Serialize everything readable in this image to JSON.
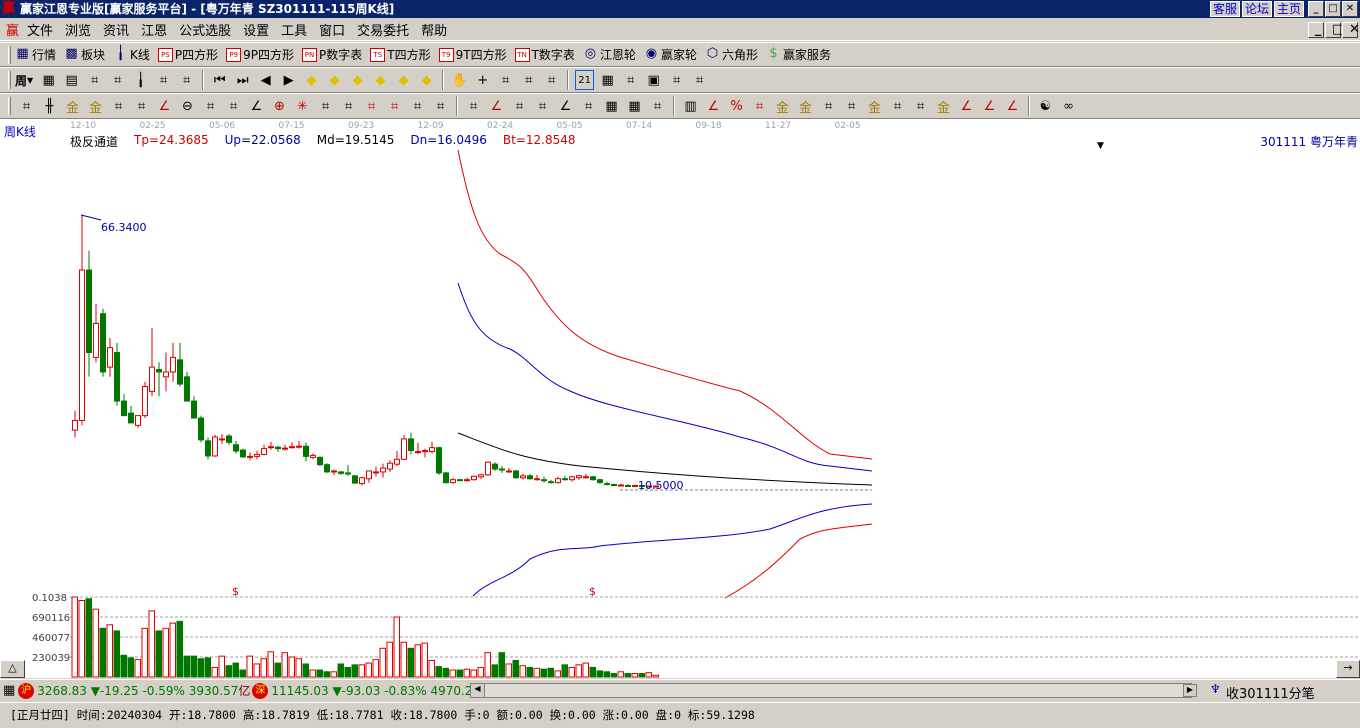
{
  "window": {
    "title": "赢家江恩专业版[赢家服务平台] - [粤万年青   SZ301111-115周K线]",
    "links": [
      "客服",
      "论坛",
      "主页"
    ],
    "controls": [
      "_",
      "□",
      "✕"
    ]
  },
  "menu": [
    "文件",
    "浏览",
    "资讯",
    "江恩",
    "公式选股",
    "设置",
    "工具",
    "窗口",
    "交易委托",
    "帮助"
  ],
  "toolbar1": [
    {
      "icon": "quote-table-icon",
      "glyph": "▦",
      "label": "行情"
    },
    {
      "icon": "sector-icon",
      "glyph": "▩",
      "label": "板块"
    },
    {
      "icon": "kline-icon",
      "glyph": "╽",
      "label": "K线"
    },
    {
      "icon": "ps-icon",
      "glyph": "PS",
      "label": "P四方形"
    },
    {
      "icon": "p9-icon",
      "glyph": "P9",
      "label": "9P四方形"
    },
    {
      "icon": "pn-icon",
      "glyph": "PN",
      "label": "P数字表"
    },
    {
      "icon": "ts-icon",
      "glyph": "TS",
      "label": "T四方形"
    },
    {
      "icon": "t9-icon",
      "glyph": "T9",
      "label": "9T四方形"
    },
    {
      "icon": "tn-icon",
      "glyph": "TN",
      "label": "T数字表"
    },
    {
      "icon": "gann-wheel-icon",
      "glyph": "◎",
      "label": "江恩轮"
    },
    {
      "icon": "winner-wheel-icon",
      "glyph": "◉",
      "label": "赢家轮"
    },
    {
      "icon": "hexagon-icon",
      "glyph": "⬡",
      "label": "六角形"
    },
    {
      "icon": "dollar-icon",
      "glyph": "$",
      "label": "赢家服务"
    }
  ],
  "toolbar2": {
    "period": "周",
    "icons": [
      "grid-icon",
      "doc-icon",
      "bars3-icon",
      "bars9-icon",
      "candle-icon",
      "extreme-icon",
      "mountain-icon",
      "first-icon",
      "last-icon",
      "left-icon",
      "right-icon",
      "up-diamond-icon",
      "right-diamond-icon",
      "down-diamond-icon",
      "star-diamond-icon",
      "cross-diamond-icon",
      "move-diamond-icon",
      "hand-icon",
      "crosshair-icon",
      "trend-icon",
      "tree-icon",
      "pattern-icon",
      "calendar-icon",
      "calculator-icon",
      "notes-icon",
      "save-icon",
      "network-icon",
      "print-icon"
    ],
    "calendar_text": "21"
  },
  "toolbar3": {
    "icons": [
      "pen-icon",
      "lines-icon",
      "gold1-icon",
      "gold2-icon",
      "fib-icon",
      "spiral-icon",
      "fan-icon",
      "circle-icon",
      "parallel-icon",
      "n2-icon",
      "angle-icon",
      "target-icon",
      "star-icon",
      "box-icon",
      "speed-icon",
      "shen-icon",
      "ying-icon",
      "comb-icon",
      "measure-icon",
      "frame-icon",
      "fan2-icon",
      "square-icon",
      "square2-icon",
      "angle2-icon",
      "wave-icon",
      "grid2-icon",
      "grid3-icon",
      "slash-icon",
      "table-icon",
      "percent-fan-icon",
      "percent-icon",
      "percent-line-icon",
      "gold-circle-icon",
      "gold-line-icon",
      "drop-icon",
      "wave2-icon",
      "gold3-icon",
      "j-icon",
      "f-icon",
      "gold-angle-icon",
      "shen-angle-icon",
      "ying-angle-icon",
      "four-angle-icon",
      "yinyang-icon",
      "infinity-icon"
    ]
  },
  "chart": {
    "period_label": "周K线",
    "indicator": "极反通道",
    "tp": "Tp=24.3685",
    "up": "Up=22.0568",
    "md": "Md=19.5145",
    "dn": "Dn=16.0496",
    "bt": "Bt=12.8548",
    "stock": "301111  粤万年青",
    "high_label": "66.3400",
    "low_label": "10.5000",
    "dates": [
      "12-10",
      "02-25",
      "05-06",
      "07-15",
      "09-23",
      "12-09",
      "02-24",
      "05-05",
      "07-14",
      "09-18",
      "11-27",
      "02-05"
    ],
    "candles": [
      [
        22,
        26,
        20.5,
        24
      ],
      [
        24,
        66.34,
        23,
        55
      ],
      [
        55,
        59,
        33,
        38
      ],
      [
        37,
        48,
        36,
        44
      ],
      [
        46,
        47,
        33,
        34
      ],
      [
        35,
        41,
        33,
        39
      ],
      [
        38,
        40,
        27,
        28
      ],
      [
        28,
        29.5,
        25,
        25
      ],
      [
        25.5,
        27,
        23.5,
        23.5
      ],
      [
        23,
        25,
        22.5,
        25
      ],
      [
        25,
        32,
        24.5,
        31
      ],
      [
        30,
        43,
        29,
        35
      ],
      [
        34.5,
        36,
        29,
        34
      ],
      [
        33,
        38,
        30,
        34
      ],
      [
        34,
        40,
        32,
        37
      ],
      [
        36.5,
        40,
        31,
        31.5
      ],
      [
        33,
        34,
        28,
        28
      ],
      [
        28,
        29,
        24.5,
        24.5
      ],
      [
        24.5,
        25,
        19.5,
        20
      ],
      [
        19.8,
        20.5,
        16,
        16.7
      ],
      [
        16.7,
        21,
        16.5,
        20.6
      ],
      [
        20,
        21.2,
        19.2,
        20.2
      ],
      [
        20.8,
        21.2,
        19,
        19.5
      ],
      [
        19,
        19.8,
        17.2,
        17.7
      ],
      [
        17.9,
        18.2,
        16.3,
        16.5
      ],
      [
        16.5,
        17.4,
        15.8,
        16.6
      ],
      [
        16.6,
        17.8,
        16,
        17
      ],
      [
        17,
        19,
        16.8,
        18.2
      ],
      [
        18.4,
        19.6,
        18,
        18.6
      ],
      [
        18.5,
        18.8,
        17.5,
        18.2
      ],
      [
        18.2,
        19,
        17.8,
        18.3
      ],
      [
        18.4,
        19.5,
        18.2,
        18.6
      ],
      [
        18.6,
        19.8,
        18.2,
        18.7
      ],
      [
        18.7,
        19.4,
        15.6,
        16.6
      ],
      [
        16.4,
        17.2,
        16,
        16.8
      ],
      [
        16.4,
        16.6,
        14.6,
        14.9
      ],
      [
        14.9,
        15.2,
        13.2,
        13.4
      ],
      [
        13.4,
        13.9,
        12.8,
        13.6
      ],
      [
        13.4,
        13.6,
        12.8,
        13.1
      ],
      [
        13.2,
        14.8,
        12.6,
        13
      ],
      [
        12.6,
        12.8,
        11,
        11.1
      ],
      [
        11,
        12.4,
        10.6,
        12.2
      ],
      [
        12,
        13.4,
        11.2,
        13.6
      ],
      [
        13.2,
        14.5,
        12.4,
        13.4
      ],
      [
        13.4,
        15.1,
        12.2,
        14.2
      ],
      [
        14,
        15.8,
        13.4,
        15.2
      ],
      [
        15,
        17.7,
        14.6,
        16
      ],
      [
        16,
        21,
        15.8,
        20.2
      ],
      [
        20.2,
        21.5,
        17,
        17.8
      ],
      [
        17.6,
        19.4,
        17,
        17.6
      ],
      [
        17.6,
        18.2,
        16.4,
        17.8
      ],
      [
        17.6,
        19.6,
        17.2,
        18.4
      ],
      [
        18.4,
        18.6,
        12.8,
        13.2
      ],
      [
        13.2,
        13.4,
        11,
        11.2
      ],
      [
        11.2,
        12.2,
        11,
        11.8
      ],
      [
        11.8,
        12,
        11.6,
        11.7
      ],
      [
        11.6,
        12.2,
        11.4,
        11.8
      ],
      [
        11.8,
        12.6,
        11.6,
        12.5
      ],
      [
        12.4,
        13,
        12,
        12.8
      ],
      [
        12.8,
        15.6,
        12.6,
        15.4
      ],
      [
        15,
        15.4,
        13.6,
        14
      ],
      [
        14,
        14.6,
        13.2,
        13.8
      ],
      [
        13.6,
        14.2,
        13.2,
        13.6
      ],
      [
        13.6,
        13.8,
        12,
        12.2
      ],
      [
        12.2,
        13,
        11.8,
        12.6
      ],
      [
        12.6,
        13,
        11.8,
        12
      ],
      [
        12,
        12.8,
        11.6,
        12
      ],
      [
        11.8,
        12.4,
        11.2,
        11.6
      ],
      [
        11.4,
        11.8,
        11,
        11.2
      ],
      [
        11.2,
        12.4,
        11,
        12
      ],
      [
        12,
        12.6,
        11.6,
        11.8
      ],
      [
        11.8,
        12.6,
        11.4,
        12.4
      ],
      [
        12.2,
        12.8,
        11.8,
        12.6
      ],
      [
        12.4,
        13,
        12,
        12.4
      ],
      [
        12.4,
        12.6,
        11.6,
        11.8
      ],
      [
        11.8,
        12,
        11,
        11.2
      ],
      [
        11,
        11.4,
        10.6,
        10.8
      ],
      [
        10.8,
        11,
        10.5,
        10.6
      ],
      [
        10.6,
        11,
        10.4,
        10.7
      ],
      [
        10.6,
        10.9,
        10.4,
        10.5
      ],
      [
        10.5,
        10.8,
        10.4,
        10.6
      ],
      [
        10.6,
        10.7,
        10.4,
        10.5
      ],
      [
        10.5,
        10.6,
        10.4,
        10.5
      ],
      [
        10.5,
        10.6,
        10.5,
        10.5
      ]
    ],
    "volume_labels": [
      "0.1038",
      "690116",
      "460077",
      "230039"
    ],
    "dollar_marks": [
      "$",
      "$"
    ],
    "volumes": [
      920000,
      880000,
      900000,
      780000,
      560000,
      600000,
      530000,
      250000,
      220000,
      200000,
      560000,
      760000,
      530000,
      560000,
      620000,
      640000,
      240000,
      240000,
      210000,
      220000,
      110000,
      240000,
      130000,
      160000,
      80000,
      240000,
      150000,
      210000,
      290000,
      160000,
      280000,
      230000,
      210000,
      150000,
      80000,
      80000,
      60000,
      60000,
      150000,
      110000,
      140000,
      140000,
      160000,
      200000,
      330000,
      400000,
      690000,
      400000,
      330000,
      370000,
      390000,
      190000,
      120000,
      100000,
      80000,
      80000,
      90000,
      80000,
      110000,
      280000,
      140000,
      280000,
      150000,
      190000,
      130000,
      110000,
      100000,
      90000,
      100000,
      70000,
      140000,
      110000,
      140000,
      160000,
      110000,
      70000,
      60000,
      40000,
      60000,
      40000,
      40000,
      40000,
      50000,
      20000
    ]
  },
  "index_bar": {
    "sh_badge": "沪",
    "sh": "3268.83 ▼-19.25 -0.59% 3930.57",
    "sh_unit": "亿",
    "sz_badge": "深",
    "sz": "11145.03 ▼-93.03 -0.83% 4970.2",
    "receive": "收301111分笔"
  },
  "status_bar": {
    "text": "[正月廿四] 时间:20240304 开:18.7800 高:18.7819 低:18.7781 收:18.7800 手:0 额:0.00 换:0.00 涨:0.00 盘:0 标:59.1298"
  },
  "colors": {
    "up": "#e00000",
    "down": "#007800",
    "title": "#0a246a",
    "blue": "#0000a0"
  }
}
